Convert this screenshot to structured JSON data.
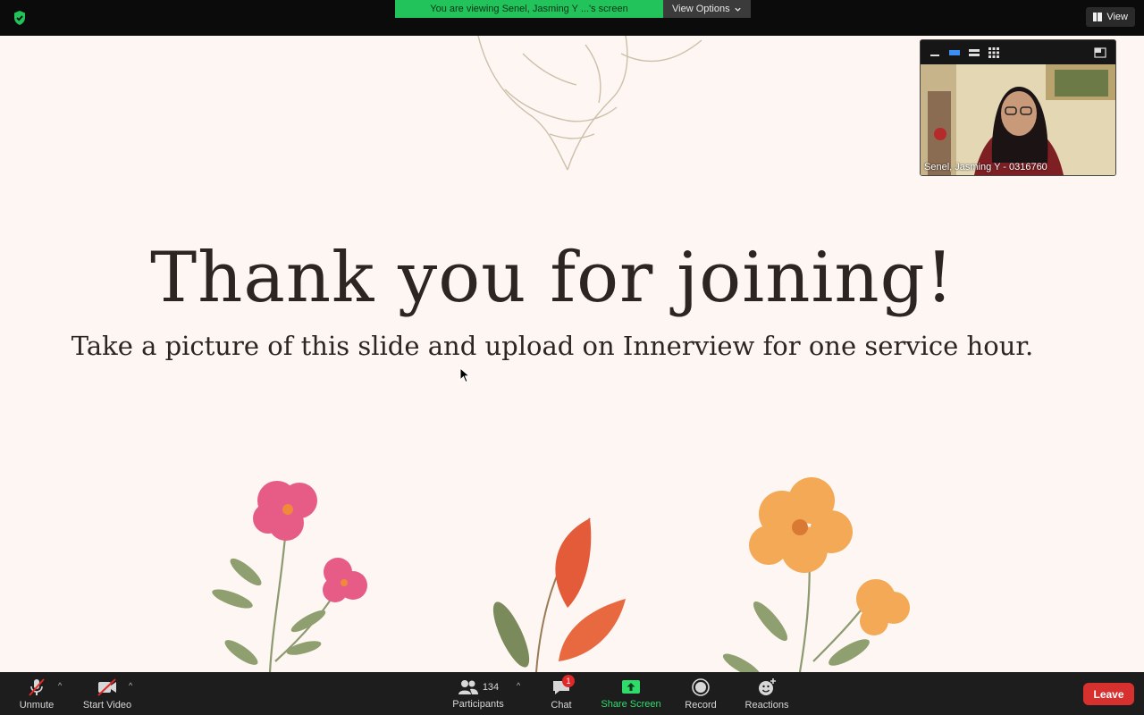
{
  "top": {
    "viewing_text": "You are viewing Senel, Jasming Y ...'s screen",
    "view_options_label": "View Options",
    "view_label": "View"
  },
  "slide": {
    "title": "Thank you for joining!",
    "subtitle": "Take a picture of this slide and upload on Innerview for one service hour."
  },
  "self_view": {
    "name": "Senel, Jasming Y - 0316760"
  },
  "toolbar": {
    "unmute_label": "Unmute",
    "start_video_label": "Start Video",
    "participants_label": "Participants",
    "participants_count": "134",
    "chat_label": "Chat",
    "chat_badge": "1",
    "share_label": "Share Screen",
    "record_label": "Record",
    "reactions_label": "Reactions",
    "leave_label": "Leave"
  },
  "colors": {
    "accent_green": "#22c35a",
    "leave_red": "#d6302f",
    "slide_bg": "#fdf6f2"
  }
}
